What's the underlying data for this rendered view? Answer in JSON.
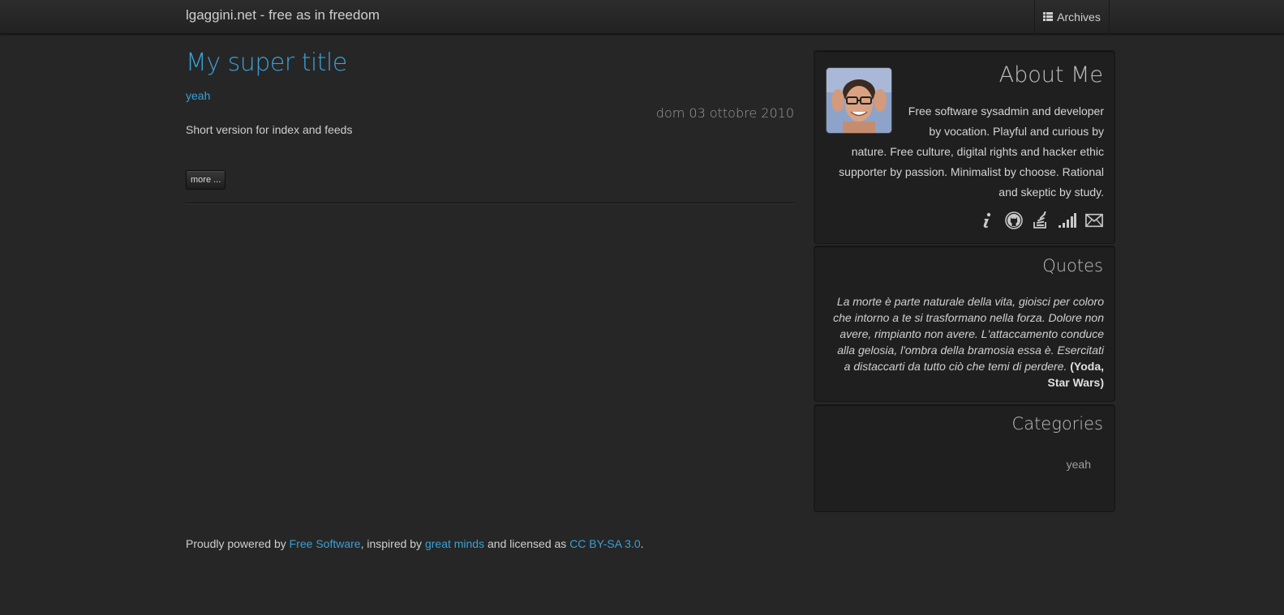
{
  "navbar": {
    "brand": "lgaggini.net - free as in freedom",
    "archives_label": "Archives",
    "archives_icon": "list-icon"
  },
  "post": {
    "title": "My super title",
    "category": "yeah",
    "date": "dom 03 ottobre 2010",
    "summary": "Short version for index and feeds",
    "more_label": "more ..."
  },
  "sidebar": {
    "about": {
      "title": "About Me",
      "text": "Free software sysadmin and developer by vocation. Playful and curious by nature. Free culture, digital rights and hacker ethic supporter by passion. Minimalist by choose. Rational and skeptic by study.",
      "social_icons": [
        "info-icon",
        "github-icon",
        "stackoverflow-icon",
        "feed-signal-icon",
        "mail-icon"
      ]
    },
    "quotes": {
      "title": "Quotes",
      "text": "La morte è parte naturale della vita, gioisci per coloro che intorno a te si trasformano nella forza. Dolore non avere, rimpianto non avere. L'attaccamento conduce alla gelosia, l'ombra della bramosia essa è. Esercitati a distaccarti da tutto ciò che temi di perdere.",
      "author": "(Yoda, Star Wars)"
    },
    "categories": {
      "title": "Categories",
      "items": [
        "yeah"
      ]
    }
  },
  "footer": {
    "prefix": "Proudly powered by ",
    "link1": "Free Software",
    "mid1": ", inspired by ",
    "link2": "great minds",
    "mid2": " and licensed as ",
    "link3": "CC BY-SA 3.0",
    "suffix": "."
  },
  "colors": {
    "background": "#262626",
    "accent": "#3aa0d6",
    "box": "#1f1f1f"
  }
}
